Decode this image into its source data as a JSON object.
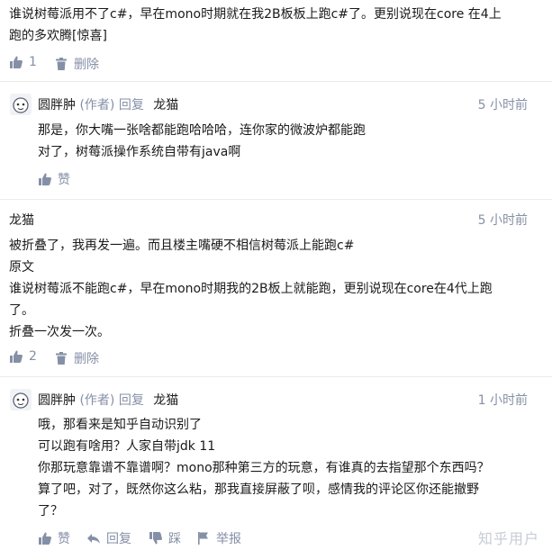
{
  "top": {
    "lines": [
      "谁说树莓派用不了c#，早在mono时期就在我2B板板上跑c#了。更别说现在core 在4上",
      "跑的多欢腾[惊喜]"
    ],
    "like_count": "1",
    "delete_label": "删除"
  },
  "reply1": {
    "author": "圆胖肿",
    "author_tag": "(作者)",
    "reply_word": "回复",
    "target": "龙猫",
    "time": "5 小时前",
    "lines": [
      "那是，你大嘴一张啥都能跑哈哈哈，连你家的微波炉都能跑",
      "对了，树莓派操作系统自带有java啊"
    ],
    "like_label": "赞"
  },
  "comment2": {
    "author": "龙猫",
    "time": "5 小时前",
    "lines": [
      "被折叠了，我再发一遍。而且楼主嘴硬不相信树莓派上能跑c#",
      "原文",
      "谁说树莓派不能跑c#，早在mono时期我的2B板上就能跑，更别说现在core在4代上跑",
      "了。",
      "折叠一次发一次。"
    ],
    "like_count": "2",
    "delete_label": "删除"
  },
  "reply2": {
    "author": "圆胖肿",
    "author_tag": "(作者)",
    "reply_word": "回复",
    "target": "龙猫",
    "time": "1 小时前",
    "lines": [
      "哦，那看来是知乎自动识别了",
      "可以跑有啥用？人家自带jdk 11",
      "你那玩意靠谱不靠谱啊？mono那种第三方的玩意，有谁真的去指望那个东西吗？",
      "算了吧，对了，既然你这么粘，那我直接屏蔽了呗，感情我的评论区你还能撤野",
      "了？"
    ],
    "like_label": "赞",
    "reply_label": "回复",
    "dislike_label": "踩",
    "report_label": "举报"
  },
  "watermark": "知乎用户",
  "colors": {
    "text": "#1a1a1a",
    "meta": "#8590a6",
    "divider": "#ebebeb",
    "watermark": "#c7ccd6"
  }
}
